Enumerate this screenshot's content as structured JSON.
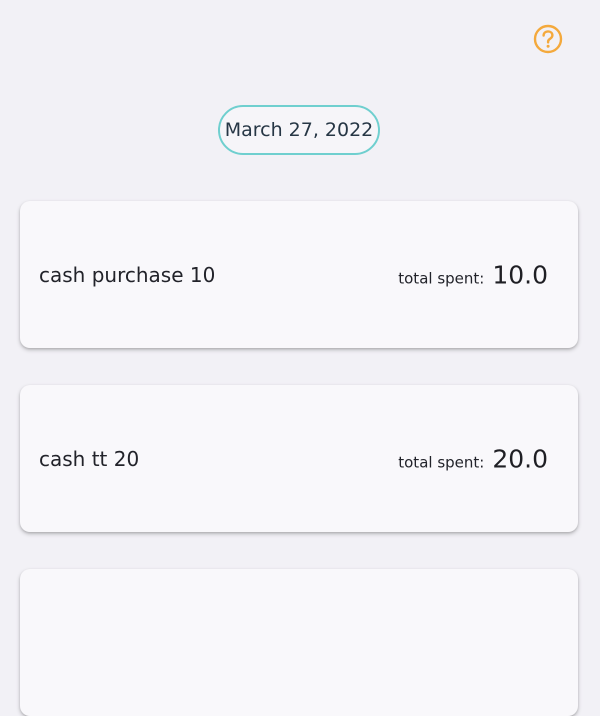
{
  "header": {
    "help_icon": "question-circle-icon",
    "accent_color": "#f4a93c"
  },
  "date_selector": {
    "label": "March 27, 2022",
    "border_color": "#6fcfcf"
  },
  "entries": [
    {
      "name": "cash purchase 10",
      "total_label": "total spent:",
      "total_value": "10.0"
    },
    {
      "name": "cash tt 20",
      "total_label": "total spent:",
      "total_value": "20.0"
    }
  ]
}
